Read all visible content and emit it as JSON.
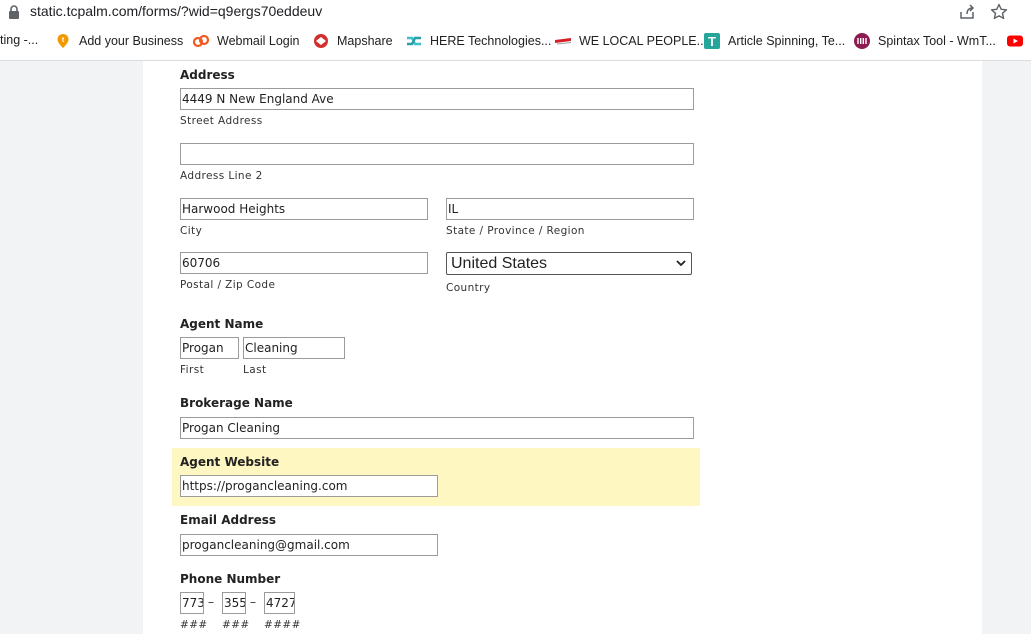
{
  "browser": {
    "url": "static.tcpalm.com/forms/?wid=q9ergs70eddeuv",
    "bookmarks": [
      {
        "label": "ting -...",
        "icon": "none"
      },
      {
        "label": "Add your Business",
        "icon": "add-business-icon"
      },
      {
        "label": "Webmail Login",
        "icon": "webmail-icon"
      },
      {
        "label": "Mapshare",
        "icon": "mapshare-icon"
      },
      {
        "label": "HERE Technologies...",
        "icon": "here-icon"
      },
      {
        "label": "WE LOCAL PEOPLE...",
        "icon": "welocal-icon"
      },
      {
        "label": "Article Spinning, Te...",
        "icon": "article-icon"
      },
      {
        "label": "Spintax Tool - WmT...",
        "icon": "spintax-icon"
      },
      {
        "label": "",
        "icon": "youtube-icon"
      }
    ]
  },
  "form": {
    "address": {
      "label": "Address",
      "street": {
        "value": "4449 N New England Ave",
        "sublabel": "Street Address"
      },
      "line2": {
        "value": "",
        "sublabel": "Address Line 2"
      },
      "city": {
        "value": "Harwood Heights",
        "sublabel": "City"
      },
      "state": {
        "value": "IL",
        "sublabel": "State / Province / Region"
      },
      "zip": {
        "value": "60706",
        "sublabel": "Postal / Zip Code"
      },
      "country": {
        "value": "United States",
        "sublabel": "Country"
      }
    },
    "agent_name": {
      "label": "Agent Name",
      "first": {
        "value": "Progan",
        "sublabel": "First"
      },
      "last": {
        "value": "Cleaning",
        "sublabel": "Last"
      }
    },
    "brokerage": {
      "label": "Brokerage Name",
      "value": "Progan Cleaning"
    },
    "website": {
      "label": "Agent Website",
      "value": "https://progancleaning.com"
    },
    "email": {
      "label": "Email Address",
      "value": "progancleaning@gmail.com"
    },
    "phone": {
      "label": "Phone Number",
      "area": {
        "value": "773",
        "sublabel": "###"
      },
      "prefix": {
        "value": "355",
        "sublabel": "###"
      },
      "line": {
        "value": "4727",
        "sublabel": "####"
      },
      "separator": "–"
    }
  },
  "colors": {
    "highlight": "#fff7c2",
    "youtube": "#ff0000"
  }
}
